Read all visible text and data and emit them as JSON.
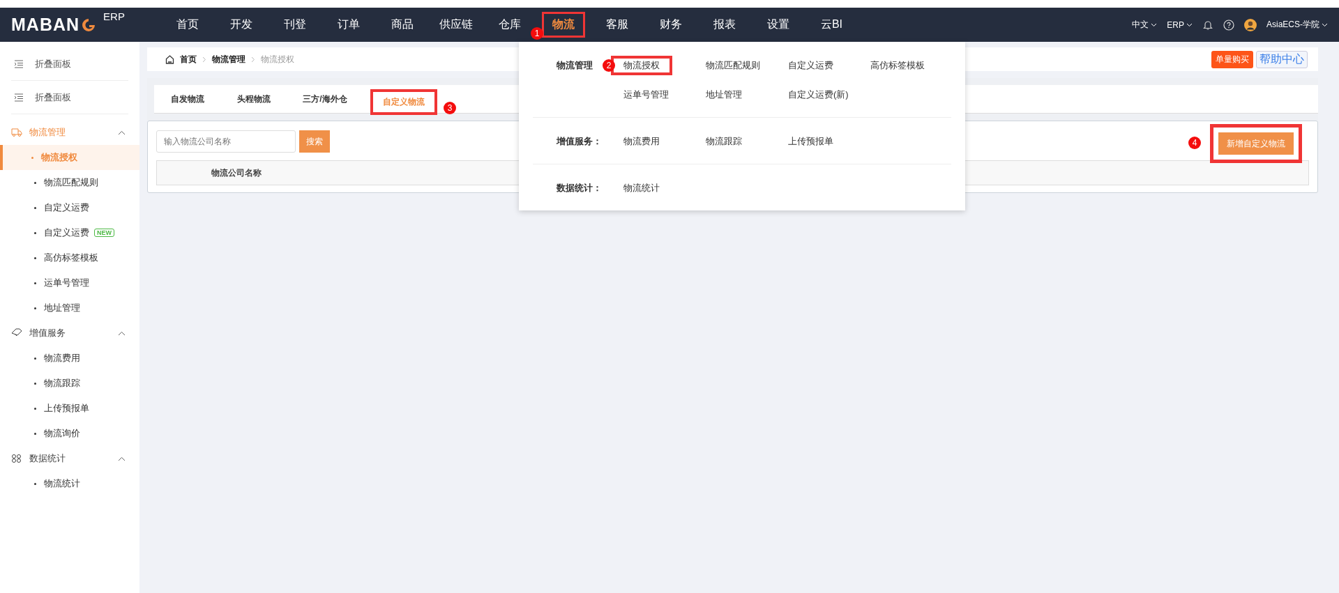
{
  "topbar": {
    "logo": "MABAN",
    "logo_suffix": "ERP",
    "nav": [
      {
        "label": "首页",
        "selected": false
      },
      {
        "label": "开发",
        "selected": false
      },
      {
        "label": "刊登",
        "selected": false
      },
      {
        "label": "订单",
        "selected": false
      },
      {
        "label": "商品",
        "selected": false
      },
      {
        "label": "供应链",
        "selected": false
      },
      {
        "label": "仓库",
        "selected": false
      },
      {
        "label": "物流",
        "selected": true,
        "highlighted": true,
        "callout": "1"
      },
      {
        "label": "客服",
        "selected": false
      },
      {
        "label": "财务",
        "selected": false
      },
      {
        "label": "报表",
        "selected": false
      },
      {
        "label": "设置",
        "selected": false
      },
      {
        "label": "云BI",
        "selected": false
      }
    ],
    "language": "中文",
    "system": "ERP",
    "user": "AsiaECS-学院"
  },
  "sidebar": {
    "collapse": [
      "折叠面板",
      "折叠面板"
    ],
    "groups": [
      {
        "label": "物流管理",
        "active": true,
        "expanded": true,
        "items": [
          {
            "label": "物流授权",
            "selected": true
          },
          {
            "label": "物流匹配规则",
            "selected": false
          },
          {
            "label": "自定义运费",
            "selected": false
          },
          {
            "label": "自定义运费",
            "selected": false,
            "badge": "NEW"
          },
          {
            "label": "高仿标签模板",
            "selected": false
          },
          {
            "label": "运单号管理",
            "selected": false
          },
          {
            "label": "地址管理",
            "selected": false
          }
        ]
      },
      {
        "label": "增值服务",
        "active": false,
        "expanded": true,
        "items": [
          {
            "label": "物流费用",
            "selected": false
          },
          {
            "label": "物流跟踪",
            "selected": false
          },
          {
            "label": "上传预报单",
            "selected": false
          },
          {
            "label": "物流询价",
            "selected": false
          }
        ]
      },
      {
        "label": "数据统计",
        "active": false,
        "expanded": true,
        "items": [
          {
            "label": "物流统计",
            "selected": false
          }
        ]
      }
    ]
  },
  "breadcrumb": [
    "首页",
    "物流管理",
    "物流授权"
  ],
  "header_buttons": [
    "单量购买",
    "帮助中心"
  ],
  "tabs": [
    {
      "label": "自发物流",
      "selected": false
    },
    {
      "label": "头程物流",
      "selected": false
    },
    {
      "label": "三方/海外仓",
      "selected": false
    },
    {
      "label": "自定义物流",
      "selected": true,
      "highlighted": true,
      "callout": "3"
    }
  ],
  "search": {
    "placeholder": "输入物流公司名称",
    "button": "搜索"
  },
  "add_button": {
    "label": "新增自定义物流",
    "highlighted": true,
    "callout": "4"
  },
  "table": {
    "columns": [
      "物流公司名称"
    ]
  },
  "dropdown": {
    "sections": [
      {
        "label": "物流管理",
        "items": [
          {
            "label": "物流授权",
            "highlighted": true,
            "callout": "2"
          },
          {
            "label": "物流匹配规则",
            "highlighted": false
          },
          {
            "label": "自定义运费",
            "highlighted": false
          },
          {
            "label": "高仿标签模板",
            "highlighted": false
          },
          {
            "label": "运单号管理",
            "highlighted": false
          },
          {
            "label": "地址管理",
            "highlighted": false
          },
          {
            "label": "自定义运费(新)",
            "highlighted": false
          }
        ]
      },
      {
        "label": "增值服务：",
        "items": [
          {
            "label": "物流费用",
            "highlighted": false
          },
          {
            "label": "物流跟踪",
            "highlighted": false
          },
          {
            "label": "上传预报单",
            "highlighted": false
          }
        ]
      },
      {
        "label": "数据统计：",
        "items": [
          {
            "label": "物流统计",
            "highlighted": false
          }
        ]
      }
    ]
  }
}
